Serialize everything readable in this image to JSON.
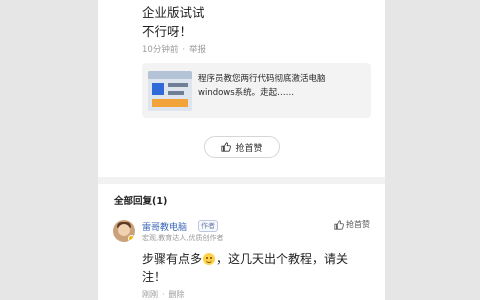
{
  "top_comment": {
    "title": "企业版试试",
    "body": "不行呀！",
    "time": "10分钟前",
    "separator": "·",
    "report": "举报"
  },
  "linked_article": {
    "title_line1": "程序员教您两行代码彻底激活电脑",
    "title_line2": "windows系统。走起……"
  },
  "like_head_button": {
    "label": "抢首赞",
    "icon": "thumb-up-icon"
  },
  "replies_section": {
    "title": "全部回复(1)"
  },
  "reply": {
    "author": "雷哥教电脑",
    "author_badge": "作者",
    "author_sub": "宏观,教育达人,优质创作者",
    "like_label": "抢首赞",
    "body_part1": "步骤有点多",
    "emoji": "smile-emoji",
    "body_part2": "，这几天出个教程，请关注！",
    "time": "刚刚",
    "separator": "·",
    "delete": "删除"
  }
}
